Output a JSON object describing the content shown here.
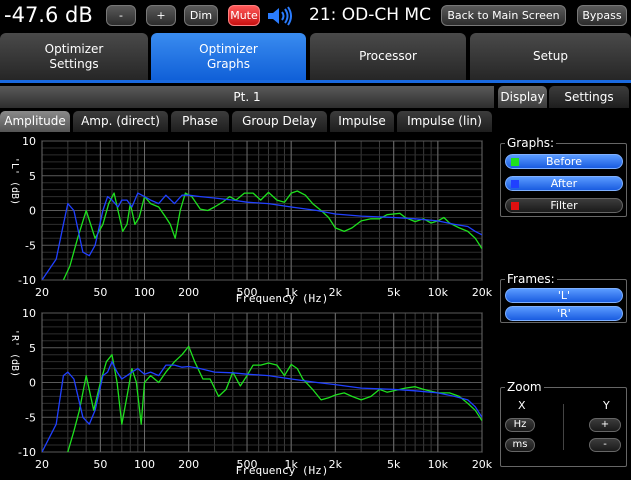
{
  "topbar": {
    "volume": "-47.6 dB",
    "minus_label": "-",
    "plus_label": "+",
    "dim_label": "Dim",
    "mute_label": "Mute",
    "preset": "21: OD-CH MC",
    "back_label": "Back to Main Screen",
    "bypass_label": "Bypass"
  },
  "main_tabs": [
    {
      "label": "Optimizer\nSettings",
      "active": false
    },
    {
      "label": "Optimizer\nGraphs",
      "active": true
    },
    {
      "label": "Processor",
      "active": false
    },
    {
      "label": "Setup",
      "active": false
    }
  ],
  "point_header": "Pt. 1",
  "sub_tabs": [
    {
      "label": "Amplitude",
      "active": true
    },
    {
      "label": "Amp. (direct)",
      "active": false
    },
    {
      "label": "Phase",
      "active": false
    },
    {
      "label": "Group Delay",
      "active": false
    },
    {
      "label": "Impulse",
      "active": false
    },
    {
      "label": "Impulse (lin)",
      "active": false
    }
  ],
  "right_panel": {
    "tabs": [
      {
        "label": "Display",
        "active": true
      },
      {
        "label": "Settings",
        "active": false
      }
    ],
    "graphs_title": "Graphs:",
    "graphs": [
      {
        "label": "Before",
        "color": "#1ee01e"
      },
      {
        "label": "After",
        "color": "#2040ff"
      },
      {
        "label": "Filter",
        "color": "#e01010"
      }
    ],
    "frames_title": "Frames:",
    "frames": [
      "'L'",
      "'R'"
    ],
    "zoom_title": "Zoom",
    "zoom_x": "X",
    "zoom_y": "Y",
    "zoom_hz": "Hz",
    "zoom_ms": "ms",
    "zoom_plus": "+",
    "zoom_minus": "-"
  },
  "colors": {
    "accent": "#1a6ae0",
    "before": "#1ee01e",
    "after": "#2040ff",
    "mute": "#e01010"
  },
  "chart_data": [
    {
      "type": "line",
      "ylabel": "'L' (dB)",
      "xlabel": "Frequency (Hz)",
      "xscale": "log",
      "xlim": [
        20,
        20000
      ],
      "ylim": [
        -10,
        10
      ],
      "x_ticks": [
        20,
        50,
        100,
        200,
        500,
        1000,
        2000,
        5000,
        10000,
        20000
      ],
      "x_tick_labels": [
        "20",
        "50",
        "100",
        "200",
        "500",
        "1k",
        "2k",
        "5k",
        "10k",
        "20k"
      ],
      "y_ticks": [
        -10,
        -5,
        0,
        5,
        10
      ],
      "grid": true,
      "series": [
        {
          "name": "Before",
          "color": "#1ee01e",
          "x": [
            28,
            31,
            35,
            40,
            46,
            52,
            57,
            62,
            66,
            71,
            76,
            80,
            86,
            92,
            100,
            110,
            125,
            140,
            150,
            162,
            175,
            190,
            210,
            240,
            270,
            300,
            340,
            380,
            420,
            480,
            550,
            620,
            700,
            800,
            900,
            1000,
            1100,
            1250,
            1400,
            1600,
            1800,
            2000,
            2300,
            2600,
            3000,
            3500,
            4000,
            4500,
            5000,
            5500,
            6000,
            7000,
            8000,
            9000,
            10000,
            11000,
            12000,
            14000,
            16000,
            18000,
            20000
          ],
          "y": [
            -10,
            -8,
            -4,
            0,
            -4,
            -2,
            1,
            2.5,
            0,
            -3,
            -2,
            1,
            -2,
            -1,
            2,
            1,
            0.5,
            -1,
            -2,
            -4,
            0,
            2.5,
            2,
            0.2,
            0,
            0.5,
            1.2,
            2,
            1.5,
            2.5,
            2.5,
            1.5,
            2.6,
            1.5,
            1.2,
            2.5,
            2.8,
            2.2,
            1,
            0,
            -1,
            -2.5,
            -3,
            -2.5,
            -1.5,
            -1.2,
            -1.2,
            -0.6,
            -0.5,
            -0.4,
            -1,
            -1.6,
            -1.2,
            -1.8,
            -1.5,
            -1,
            -1.8,
            -2.5,
            -3,
            -4,
            -5.5
          ]
        },
        {
          "name": "After",
          "color": "#2040ff",
          "x": [
            20,
            25,
            28,
            30,
            33,
            38,
            42,
            46,
            52,
            56,
            60,
            66,
            70,
            76,
            82,
            90,
            100,
            110,
            125,
            140,
            160,
            180,
            200,
            240,
            300,
            400,
            500,
            700,
            1000,
            1500,
            2000,
            3000,
            5000,
            7000,
            10000,
            13000,
            16000,
            18000,
            20000
          ],
          "y": [
            -10,
            -7,
            -2,
            1,
            0,
            -6,
            -6.5,
            -5,
            0,
            2,
            1.5,
            0.5,
            1.5,
            1.5,
            0.5,
            2.5,
            2,
            1.5,
            1,
            2.2,
            1,
            2.2,
            2.2,
            2,
            1.8,
            1.5,
            1.2,
            1,
            0.5,
            0,
            -0.5,
            -0.8,
            -1,
            -1.2,
            -1.5,
            -2,
            -2.3,
            -3,
            -3.5
          ]
        }
      ]
    },
    {
      "type": "line",
      "ylabel": "'R' (dB)",
      "xlabel": "Frequency (Hz)",
      "xscale": "log",
      "xlim": [
        20,
        20000
      ],
      "ylim": [
        -10,
        10
      ],
      "x_ticks": [
        20,
        50,
        100,
        200,
        500,
        1000,
        2000,
        5000,
        10000,
        20000
      ],
      "x_tick_labels": [
        "20",
        "50",
        "100",
        "200",
        "500",
        "1k",
        "2k",
        "5k",
        "10k",
        "20k"
      ],
      "y_ticks": [
        -10,
        -5,
        0,
        5,
        10
      ],
      "grid": true,
      "series": [
        {
          "name": "Before",
          "color": "#1ee01e",
          "x": [
            30,
            33,
            36,
            40,
            45,
            50,
            55,
            60,
            65,
            70,
            76,
            82,
            88,
            95,
            100,
            110,
            125,
            140,
            160,
            180,
            200,
            220,
            250,
            280,
            320,
            360,
            400,
            450,
            500,
            550,
            620,
            700,
            800,
            900,
            1000,
            1100,
            1200,
            1400,
            1600,
            1800,
            2000,
            2300,
            2600,
            3000,
            3500,
            4000,
            4500,
            5000,
            6000,
            7000,
            8000,
            10000,
            12000,
            14000,
            16000,
            18000,
            20000
          ],
          "y": [
            -10,
            -7,
            -4,
            1,
            -4,
            0,
            3,
            4,
            0,
            -6,
            -2,
            2,
            0,
            -6,
            0,
            1,
            0,
            1.5,
            3,
            4,
            5.2,
            3,
            0.5,
            0.5,
            -2,
            -1,
            1.5,
            -0.5,
            1,
            2.5,
            2.5,
            2.8,
            2.5,
            1,
            2.6,
            2,
            0.5,
            -1,
            -2.5,
            -2.2,
            -1.8,
            -1.5,
            -2,
            -2.5,
            -2,
            -1,
            -1.4,
            -1.2,
            -0.8,
            -0.6,
            -1,
            -1.5,
            -1.5,
            -2,
            -3,
            -4,
            -5.5
          ]
        },
        {
          "name": "After",
          "color": "#2040ff",
          "x": [
            20,
            25,
            28,
            30,
            33,
            38,
            42,
            46,
            52,
            56,
            60,
            65,
            70,
            76,
            82,
            90,
            100,
            110,
            125,
            140,
            160,
            180,
            200,
            240,
            300,
            400,
            500,
            700,
            1000,
            1500,
            2000,
            3000,
            5000,
            7000,
            10000,
            13000,
            16000,
            18000,
            20000
          ],
          "y": [
            -10,
            -6,
            1,
            1.5,
            0.5,
            -5,
            -6,
            -4,
            1,
            1.5,
            3,
            1.5,
            0.5,
            1,
            1.5,
            2,
            1.2,
            1.5,
            1,
            2.5,
            2.5,
            2.2,
            2.3,
            2,
            1.5,
            1.4,
            1.2,
            1,
            0.5,
            0,
            -0.3,
            -0.8,
            -1,
            -1.2,
            -1.5,
            -2,
            -2.5,
            -3.5,
            -5
          ]
        }
      ]
    }
  ]
}
